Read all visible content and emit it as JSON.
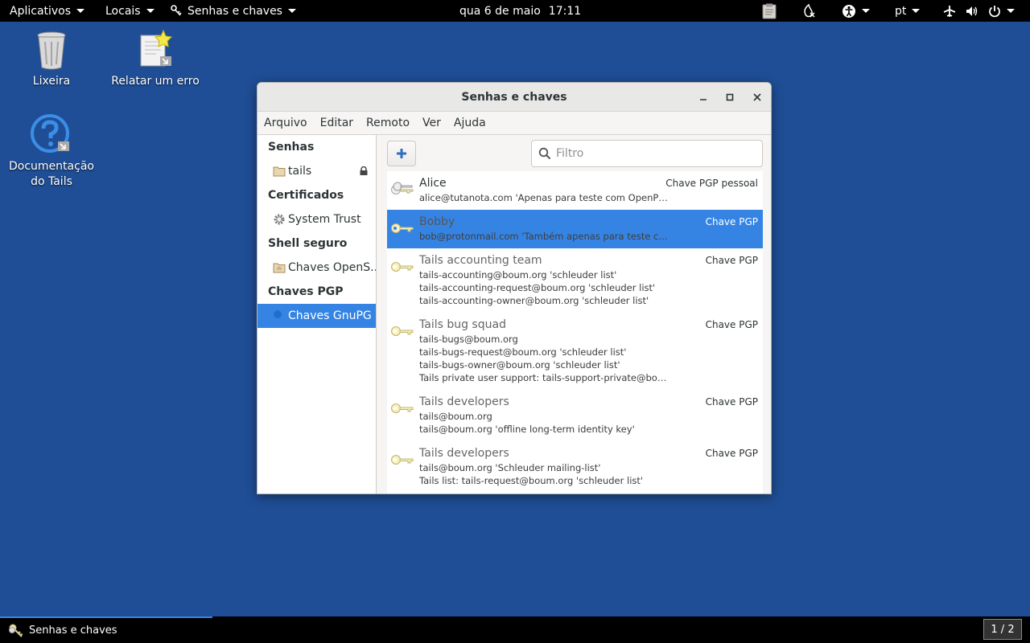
{
  "topbar": {
    "apps_label": "Aplicativos",
    "places_label": "Locais",
    "app_label": "Senhas e chaves",
    "date": "qua 6 de maio",
    "time": "17:11",
    "lang": "pt"
  },
  "desktop": {
    "trash": "Lixeira",
    "report": "Relatar um erro",
    "docs_line1": "Documentação",
    "docs_line2": "do Tails"
  },
  "window": {
    "title": "Senhas e chaves",
    "menu": [
      "Arquivo",
      "Editar",
      "Remoto",
      "Ver",
      "Ajuda"
    ],
    "sidebar": {
      "sections": [
        {
          "title": "Senhas",
          "item": "tails"
        },
        {
          "title": "Certificados",
          "item": "System Trust"
        },
        {
          "title": "Shell seguro",
          "item": "Chaves OpenS..."
        },
        {
          "title": "Chaves PGP",
          "item": "Chaves GnuPG"
        }
      ]
    },
    "filter_placeholder": "Filtro",
    "keys": [
      {
        "name": "Alice",
        "type": "Chave PGP pessoal",
        "lines": [
          "alice@tutanota.com 'Apenas para teste com OpenPGP (..."
        ]
      },
      {
        "name": "Bobby",
        "type": "Chave PGP",
        "lines": [
          "bob@protonmail.com 'Também apenas para teste com ..."
        ]
      },
      {
        "name": "Tails accounting team",
        "type": "Chave PGP",
        "lines": [
          "tails-accounting@boum.org 'schleuder list'",
          "tails-accounting-request@boum.org 'schleuder list'",
          "tails-accounting-owner@boum.org 'schleuder list'"
        ]
      },
      {
        "name": "Tails bug squad",
        "type": "Chave PGP",
        "lines": [
          "tails-bugs@boum.org",
          "tails-bugs-request@boum.org 'schleuder list'",
          "tails-bugs-owner@boum.org 'schleuder list'",
          "Tails private user support: tails-support-private@boum..."
        ]
      },
      {
        "name": "Tails developers",
        "type": "Chave PGP",
        "lines": [
          "tails@boum.org",
          "tails@boum.org 'offline long-term identity key'"
        ]
      },
      {
        "name": "Tails developers",
        "type": "Chave PGP",
        "lines": [
          "tails@boum.org 'Schleuder mailing-list'",
          "Tails list: tails-request@boum.org 'schleuder list'"
        ]
      }
    ]
  },
  "taskbar": {
    "task_label": "Senhas e chaves",
    "pager": "1 / 2"
  },
  "colors": {
    "desktop": "#1f4e96",
    "accent": "#3584e4"
  }
}
